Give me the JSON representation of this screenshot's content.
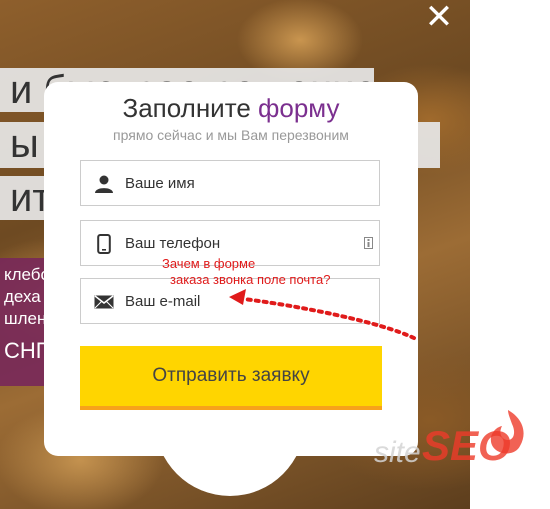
{
  "background": {
    "lines": [
      "и быстрое решение",
      "ы м",
      "ите"
    ],
    "promo_lines": [
      "клебо",
      "деха п",
      "шлен",
      "СНГ"
    ]
  },
  "close_label": "✕",
  "form": {
    "title_main": "Заполните ",
    "title_accent": "форму",
    "subtitle": "прямо сейчас и мы Вам перезвоним",
    "fields": {
      "name_placeholder": "Ваше имя",
      "phone_placeholder": "Ваш телефон",
      "email_placeholder": "Ваш e-mail"
    },
    "submit_label": "Отправить заявку"
  },
  "annotation": {
    "line1": "Зачем в форме",
    "line2": "заказа звонка поле почта?"
  },
  "watermark": {
    "text_gray": "site",
    "text_red": "SEO"
  },
  "colors": {
    "accent": "#7b2f8f",
    "button": "#ffd500",
    "button_edge": "#f7a21b",
    "annotation": "#e01b1b"
  }
}
